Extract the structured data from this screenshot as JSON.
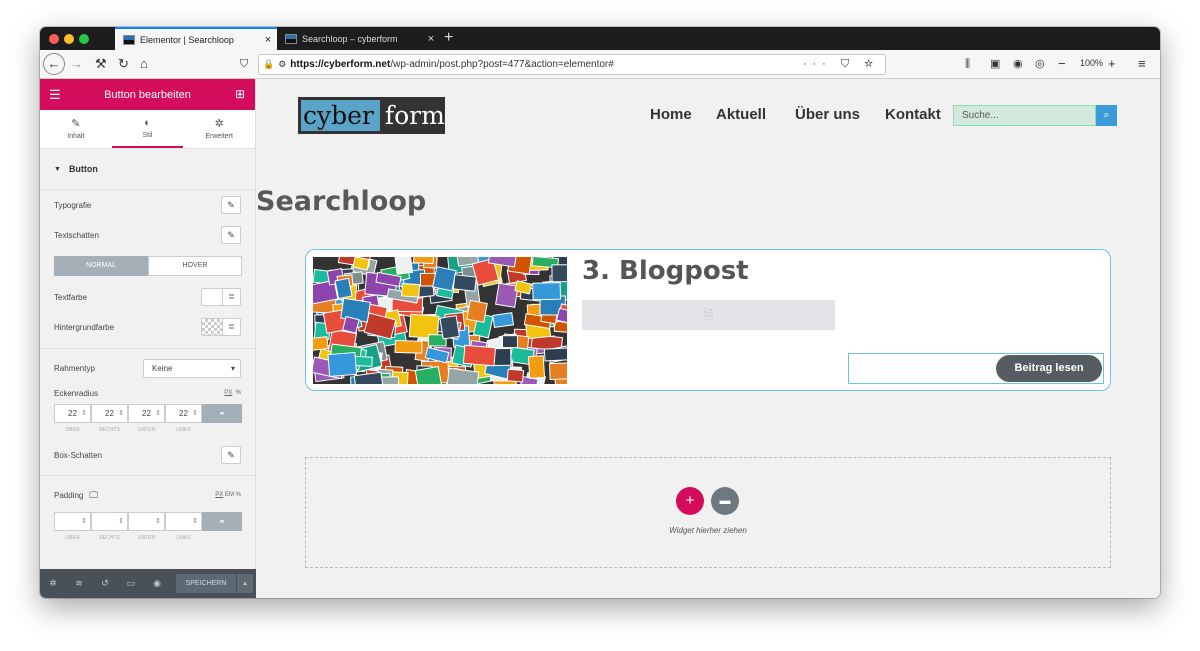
{
  "tabs": [
    {
      "title": "Elementor | Searchloop",
      "close": "×"
    },
    {
      "title": "Searchloop – cyberform",
      "close": "×"
    }
  ],
  "newtab": "+",
  "nav": {
    "url_domain": "https://cyberform.net",
    "url_path": "/wp-admin/post.php?post=477&action=elementor#",
    "zoom": "100%"
  },
  "sidebar": {
    "header_title": "Button bearbeiten",
    "tabs": [
      {
        "label": "Inhalt"
      },
      {
        "label": "Stil"
      },
      {
        "label": "Erweitert"
      }
    ],
    "section_title": "Button",
    "typografie": "Typografie",
    "textschatten": "Textschatten",
    "toggle_normal": "NORMAL",
    "toggle_hover": "HOVER",
    "textfarbe": "Textfarbe",
    "hintergrundfarbe": "Hintergrundfarbe",
    "rahmentyp": "Rahmentyp",
    "rahmentyp_value": "Keine",
    "eckenradius": "Eckenradius",
    "unit_px": "PX",
    "unit_em": "EM",
    "unit_pct": "%",
    "radius_values": [
      "22",
      "22",
      "22",
      "22"
    ],
    "dim_labels": [
      "OBEN",
      "RECHTS",
      "UNTEN",
      "LINKS"
    ],
    "box_schatten": "Box-Schatten",
    "padding": "Padding",
    "save_label": "SPEICHERN"
  },
  "site": {
    "logo_part1": "cyber",
    "logo_part2": "form",
    "menu": [
      "Home",
      "Aktuell",
      "Über uns",
      "Kontakt"
    ],
    "search_placeholder": "Suche...",
    "page_title": "Searchloop",
    "post_title": "3. Blogpost",
    "read_more": "Beitrag lesen",
    "widget_hint": "Widget hierher ziehen"
  },
  "colors": {
    "accent": "#d30c5c",
    "button": "#555d63",
    "search_bg": "#d3e9dc",
    "logo_blue": "#5aa3c9"
  }
}
